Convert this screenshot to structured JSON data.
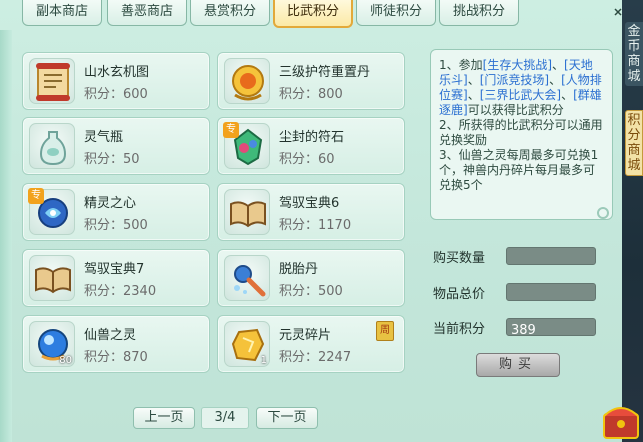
{
  "tabs": [
    {
      "label": "副本商店",
      "active": false
    },
    {
      "label": "善恶商店",
      "active": false
    },
    {
      "label": "悬赏积分",
      "active": false
    },
    {
      "label": "比武积分",
      "active": true
    },
    {
      "label": "师徒积分",
      "active": false
    },
    {
      "label": "挑战积分",
      "active": false
    }
  ],
  "items": [
    {
      "name": "山水玄机图",
      "price": "积分：600",
      "icon": "scroll-icon"
    },
    {
      "name": "三级护符重置丹",
      "price": "积分：800",
      "icon": "golden-amulet-icon"
    },
    {
      "name": "灵气瓶",
      "price": "积分：50",
      "icon": "vase-icon"
    },
    {
      "name": "尘封的符石",
      "price": "积分：60",
      "icon": "rune-stone-icon",
      "badge": "专"
    },
    {
      "name": "精灵之心",
      "price": "积分：500",
      "icon": "spirit-heart-icon",
      "badge": "专"
    },
    {
      "name": "驾驭宝典6",
      "price": "积分：1170",
      "icon": "book-icon"
    },
    {
      "name": "驾驭宝典7",
      "price": "积分：2340",
      "icon": "book-icon"
    },
    {
      "name": "脱胎丹",
      "price": "积分：500",
      "icon": "elixir-icon"
    },
    {
      "name": "仙兽之灵",
      "price": "积分：870",
      "icon": "beast-spirit-orb-icon",
      "qty": "80"
    },
    {
      "name": "元灵碎片",
      "price": "积分：2247",
      "icon": "yuanling-shard-icon",
      "qty": "1",
      "tag": "周"
    }
  ],
  "info": {
    "line1_pre": "1、参加",
    "link1": "[生存大挑战]",
    "sep1": "、",
    "link2": "[天地乐斗]",
    "sep2": "、",
    "link3": "[门派竞技场]",
    "sep3": "、",
    "link4": "[人物排位赛]",
    "sep4": "、",
    "link5": "[三界比武大会]",
    "sep5": "、",
    "link6": "[群雄逐鹿]",
    "line1_post": "可以获得比武积分",
    "line2": "2、所获得的比武积分可以通用兑换奖励",
    "line3": "3、仙兽之灵每周最多可兑换1个，神兽内丹碎片每月最多可兑换5个"
  },
  "purchase": {
    "qty_label": "购买数量",
    "total_label": "物品总价",
    "points_label": "当前积分",
    "qty_value": "",
    "total_value": "",
    "points_value": "389",
    "buy_label": "购买"
  },
  "pagination": {
    "prev": "上一页",
    "page": "3/4",
    "next": "下一页"
  },
  "hud": {
    "tab1": "金币商城",
    "tab2": "积分商城"
  },
  "colors": {
    "active_tab": "#fbe9a6",
    "link": "#2a6fd1",
    "panel_bg": "#c9ece0"
  }
}
